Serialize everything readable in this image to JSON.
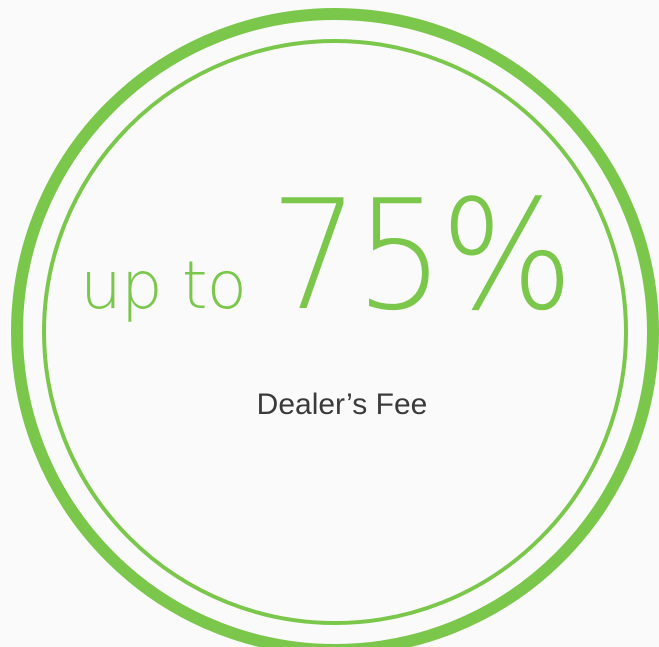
{
  "badge": {
    "prefix": "up to",
    "value": "75%",
    "label": "Dealer’s Fee"
  },
  "colors": {
    "accent": "#7ac74b",
    "background": "#fafafa",
    "text": "#3a3a3a"
  }
}
